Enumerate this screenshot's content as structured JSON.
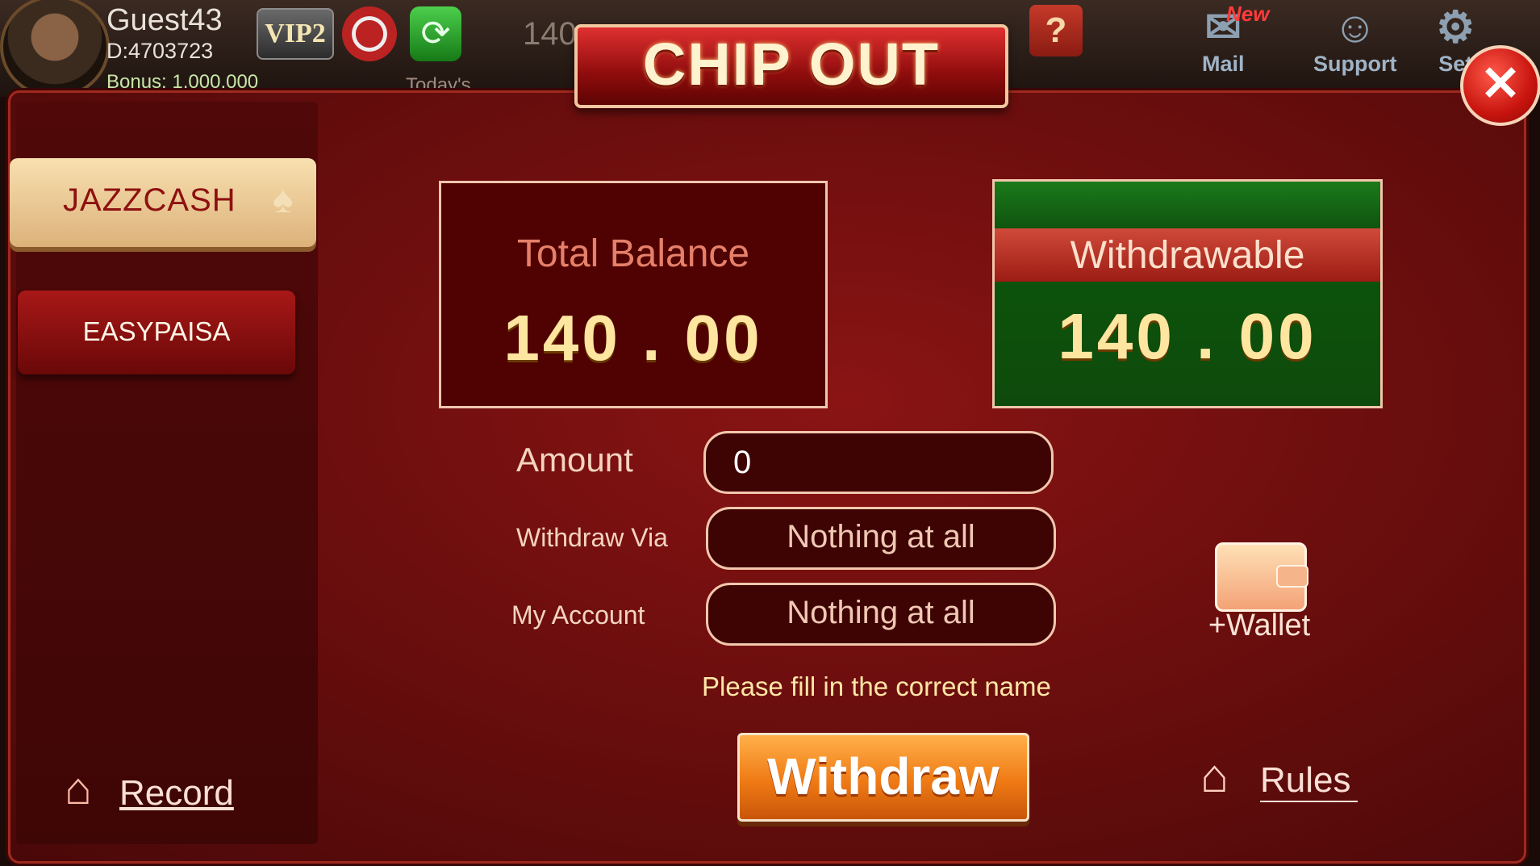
{
  "player": {
    "name": "Guest43",
    "id": "D:4703723",
    "bonus": "Bonus: 1,000,000",
    "vip": "VIP2"
  },
  "background": {
    "balance_peek": "140",
    "today_label": "Today's"
  },
  "top_nav": {
    "help": "?",
    "mail_badge": "New",
    "mail": "Mail",
    "support": "Support",
    "settings": "Set"
  },
  "dialog": {
    "title": "CHIP OUT",
    "close": "✕"
  },
  "sidebar": {
    "tabs": [
      {
        "label": "JAZZCASH",
        "active": true
      },
      {
        "label": "EASYPAISA",
        "active": false
      }
    ],
    "record": "Record"
  },
  "balances": {
    "total_label": "Total Balance",
    "total_value": "140 . 00",
    "withdrawable_label": "Withdrawable",
    "withdrawable_value": "140 . 00"
  },
  "form": {
    "amount_label": "Amount",
    "amount_value": "0",
    "via_label": "Withdraw Via",
    "via_value": "Nothing at all",
    "account_label": "My Account",
    "account_value": "Nothing at all",
    "hint": "Please fill in the correct name"
  },
  "actions": {
    "withdraw": "Withdraw",
    "add_wallet": "+Wallet",
    "rules": "Rules"
  },
  "colors": {
    "accent": "#ef7a14",
    "panel_green": "#0e4a0c",
    "dialog_red": "#6d0e0e",
    "tab_gold": "#dcb27a"
  }
}
